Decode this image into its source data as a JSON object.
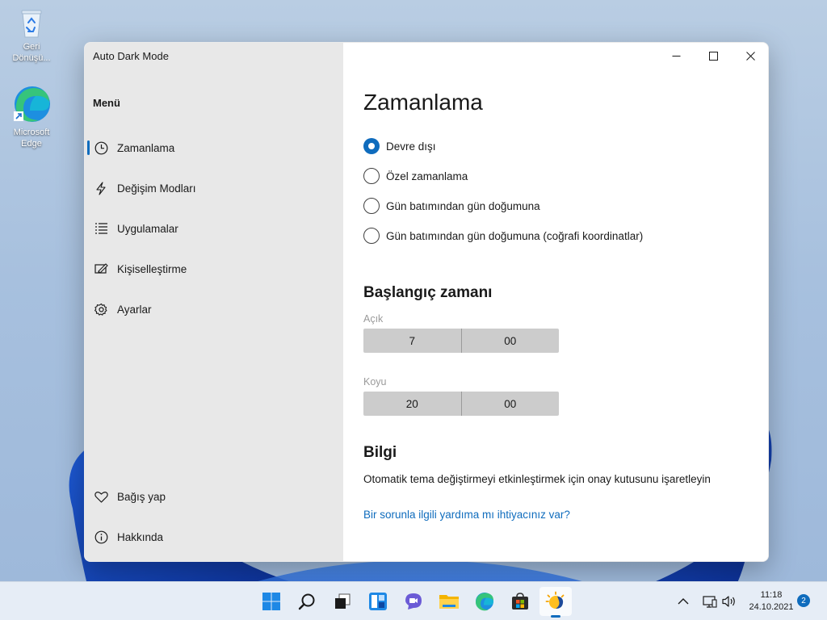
{
  "desktop": {
    "icons": [
      {
        "label": "Geri Dönüşü...",
        "icon": "recycle-bin-icon"
      },
      {
        "label": "Microsoft Edge",
        "icon": "edge-icon"
      }
    ]
  },
  "window": {
    "title": "Auto Dark Mode",
    "menu_heading": "Menü",
    "nav": [
      {
        "label": "Zamanlama",
        "icon": "clock-icon",
        "active": true
      },
      {
        "label": "Değişim Modları",
        "icon": "lightning-icon"
      },
      {
        "label": "Uygulamalar",
        "icon": "list-icon"
      },
      {
        "label": "Kişiselleştirme",
        "icon": "personalize-icon"
      },
      {
        "label": "Ayarlar",
        "icon": "gear-icon"
      }
    ],
    "footer_nav": [
      {
        "label": "Bağış yap",
        "icon": "heart-icon"
      },
      {
        "label": "Hakkında",
        "icon": "info-icon"
      }
    ],
    "caption_buttons": [
      "minimize",
      "maximize",
      "close"
    ]
  },
  "main": {
    "title": "Zamanlama",
    "options": [
      {
        "label": "Devre dışı",
        "selected": true
      },
      {
        "label": "Özel zamanlama",
        "selected": false
      },
      {
        "label": "Gün batımından gün doğumuna",
        "selected": false
      },
      {
        "label": "Gün batımından gün doğumuna (coğrafi koordinatlar)",
        "selected": false
      }
    ],
    "start_time": {
      "heading": "Başlangıç zamanı",
      "light": {
        "label": "Açık",
        "hour": "7",
        "minute": "00"
      },
      "dark": {
        "label": "Koyu",
        "hour": "20",
        "minute": "00"
      }
    },
    "info": {
      "heading": "Bilgi",
      "text": "Otomatik tema değiştirmeyi etkinleştirmek için onay kutusunu işaretleyin",
      "link": "Bir sorunla ilgili yardıma mı ihtiyacınız var?"
    }
  },
  "taskbar": {
    "apps": [
      "start-icon",
      "search-icon",
      "task-view-icon",
      "widgets-icon",
      "chat-icon",
      "file-explorer-icon",
      "edge-icon",
      "store-icon",
      "auto-dark-mode-icon"
    ],
    "tray": [
      "chevron-up-icon",
      "network-icon",
      "volume-icon"
    ],
    "time": "11:18",
    "date": "24.10.2021",
    "notification_count": "2"
  },
  "colors": {
    "accent": "#0f6cbd",
    "sidebar": "#e8e8e8",
    "picker": "#cccccc"
  }
}
